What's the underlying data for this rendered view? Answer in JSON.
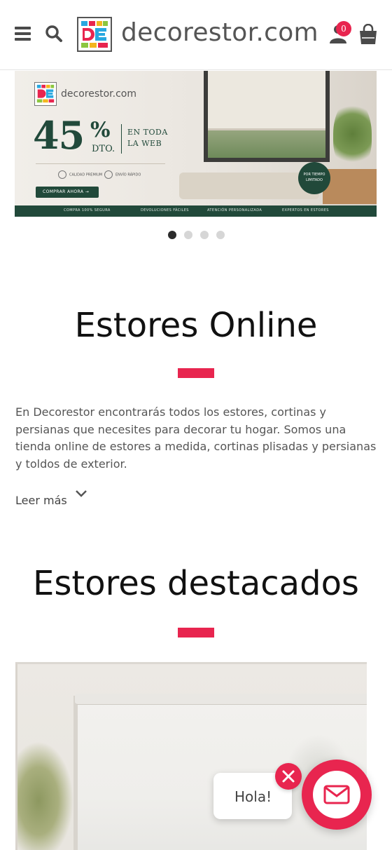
{
  "header": {
    "logo_text": "decorestor.com",
    "cart_count": "0",
    "icons": [
      "menu-icon",
      "search-icon",
      "logo-mark",
      "user-icon",
      "shopping-bag-icon"
    ],
    "accent_color": "#e8254f"
  },
  "banner": {
    "logo_text": "decorestor.com",
    "discount_number": "45",
    "discount_symbol": "%",
    "discount_suffix": "DTO.",
    "side_line1": "EN TODA",
    "side_line2": "LA WEB",
    "badge_quality": "CALIDAD PREMIUM",
    "badge_shipping": "ENVÍO RÁPIDO",
    "cta": "COMPRAR AHORA →",
    "stamp_line1": "POR TIEMPO",
    "stamp_line2": "LIMITADO",
    "footer": [
      "COMPRA 100% SEGURA",
      "DEVOLUCIONES FÁCILES",
      "ATENCIÓN PERSONALIZADA",
      "EXPERTOS EN ESTORES"
    ],
    "brand_color": "#21493a"
  },
  "carousel": {
    "slides": 4,
    "active_index": 0
  },
  "intro": {
    "title": "Estores Online",
    "text": "En Decorestor encontrarás todos los estores, cortinas y persianas que necesites para decorar tu hogar. Somos una tienda online de estores a medida, cortinas plisadas y persianas y toldos de exterior.",
    "read_more": "Leer más"
  },
  "featured": {
    "title": "Estores destacados"
  },
  "chat": {
    "greeting": "Hola!"
  }
}
